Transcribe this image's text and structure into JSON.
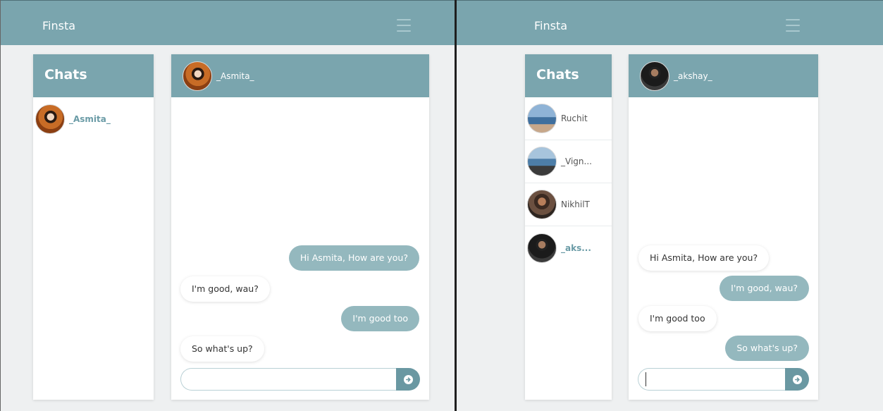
{
  "panes": [
    {
      "brand": "Finsta",
      "chats_title": "Chats",
      "chats": [
        {
          "name": "_Asmita_",
          "active": true,
          "avatar": "asmita-avatar"
        }
      ],
      "conversation": {
        "contact": "_Asmita_",
        "avatar": "asmita-avatar",
        "messages": [
          {
            "text": "Hi Asmita, How are you?",
            "from": "me"
          },
          {
            "text": "I'm good, wau?",
            "from": "them"
          },
          {
            "text": "I'm good too",
            "from": "me"
          },
          {
            "text": "So what's up?",
            "from": "them"
          }
        ],
        "input_value": "",
        "input_placeholder": ""
      }
    },
    {
      "brand": "Finsta",
      "chats_title": "Chats",
      "chats": [
        {
          "name": "Ruchit",
          "active": false,
          "avatar": "ruchit-avatar"
        },
        {
          "name": "_Vign...",
          "active": false,
          "avatar": "vign-avatar"
        },
        {
          "name": "NikhilT",
          "active": false,
          "avatar": "nikhil-avatar"
        },
        {
          "name": "_aks...",
          "active": true,
          "avatar": "akshay-avatar"
        }
      ],
      "conversation": {
        "contact": "_akshay_",
        "avatar": "akshay-avatar",
        "messages": [
          {
            "text": "Hi Asmita, How are you?",
            "from": "them"
          },
          {
            "text": "I'm good, wau?",
            "from": "me"
          },
          {
            "text": "I'm good too",
            "from": "them"
          },
          {
            "text": "So what's up?",
            "from": "me"
          }
        ],
        "input_value": "",
        "input_placeholder": ""
      }
    }
  ],
  "icons": {
    "menu": "hamburger-menu-icon",
    "send": "send-arrow-icon"
  },
  "colors": {
    "primary": "#7aa5ae",
    "sent_bubble": "#94b8be",
    "send_button": "#6a98a2",
    "active_chat_text": "#6a9ba6"
  }
}
